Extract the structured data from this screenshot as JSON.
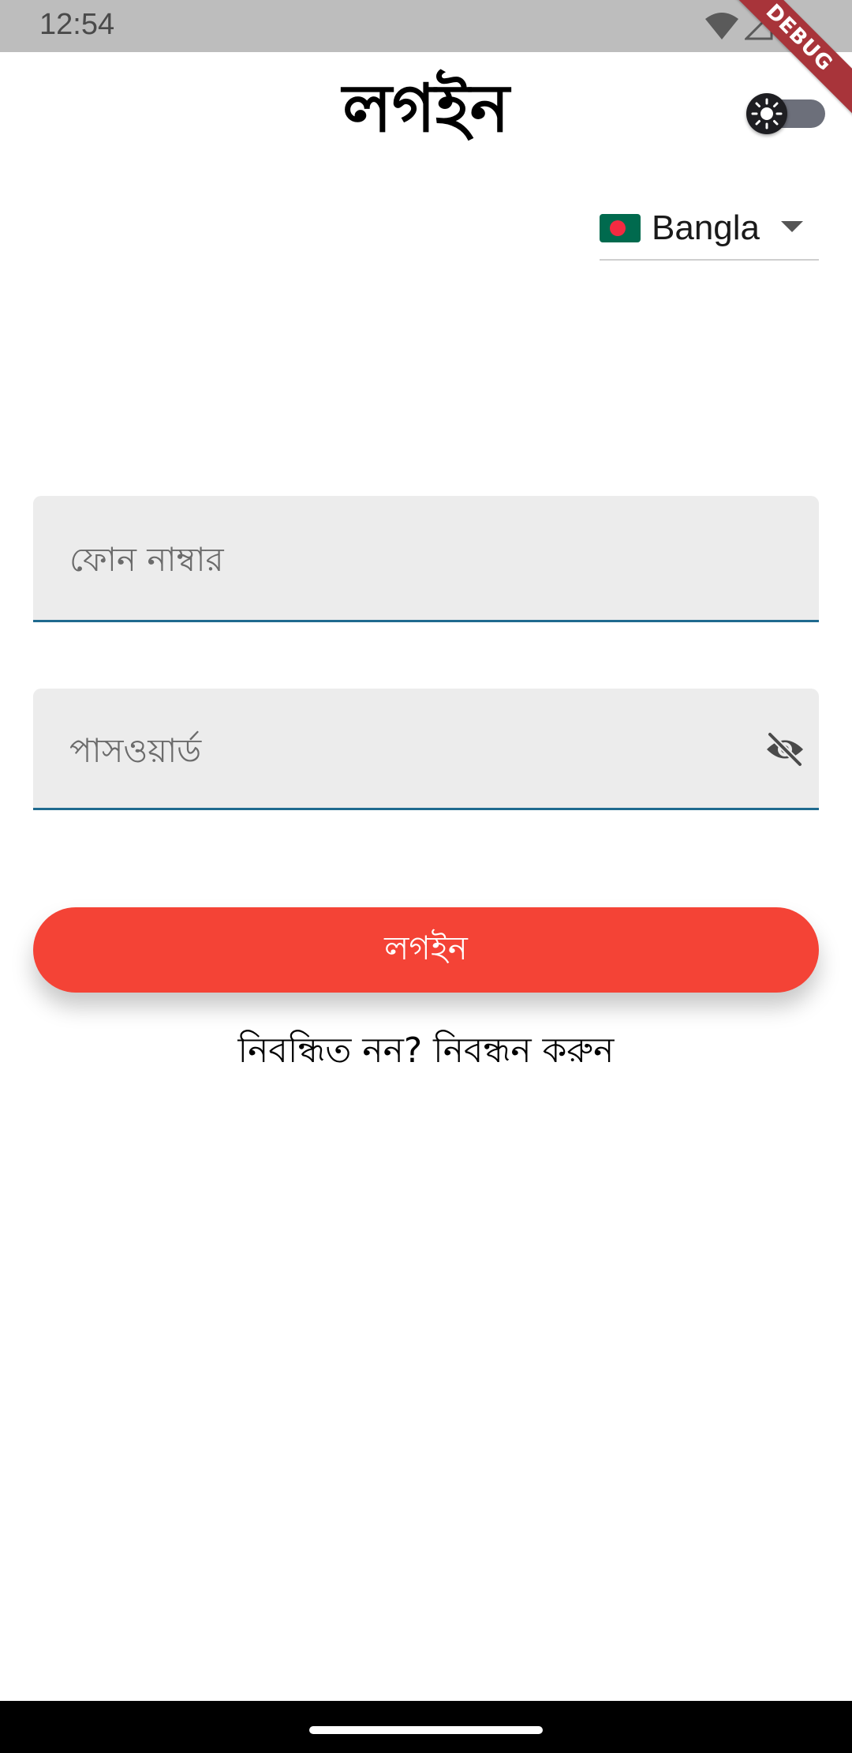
{
  "status_bar": {
    "time": "12:54",
    "icons": [
      "wifi-icon",
      "signal-icon",
      "battery-icon"
    ],
    "debug_label": "DEBUG"
  },
  "header": {
    "title": "লগইন",
    "theme_toggle": {
      "icon": "sun-icon",
      "state": "off"
    }
  },
  "language": {
    "flag": "bangladesh-flag",
    "selected": "Bangla"
  },
  "form": {
    "phone_placeholder": "ফোন নাম্বার",
    "password_placeholder": "পাসওয়ার্ড",
    "password_visibility_icon": "eye-off-icon"
  },
  "login_button": {
    "label": "লগইন"
  },
  "register_link": {
    "label": "নিবন্ধিত নন? নিবন্ধন করুন"
  },
  "colors": {
    "primary_button": "#f44336",
    "field_underline": "#1f6a8f",
    "field_background": "#ececec",
    "status_bar": "#bdbdbd",
    "debug_ribbon": "#a8343a"
  }
}
